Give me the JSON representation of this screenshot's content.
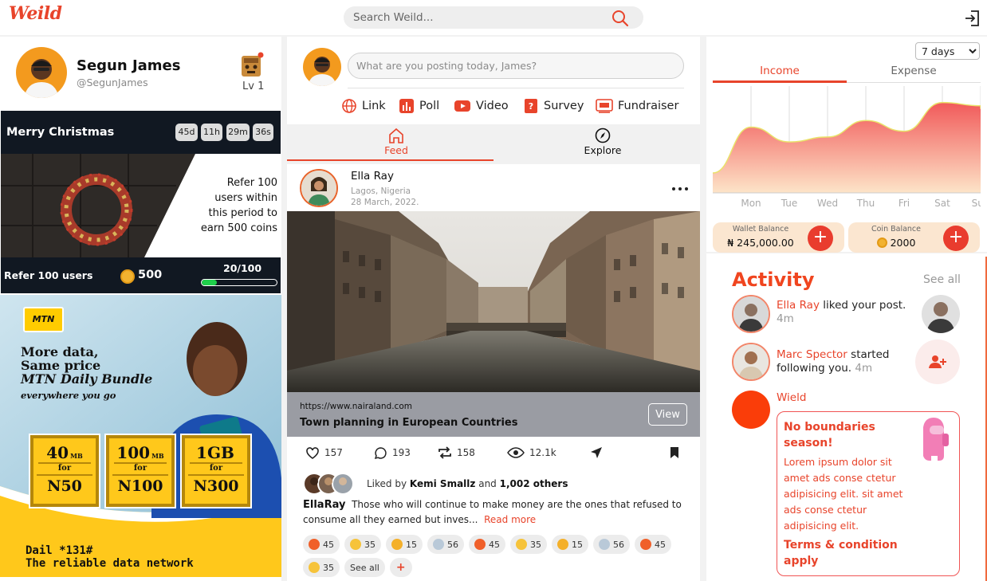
{
  "brand": {
    "logo": "Weild",
    "accent": "#e8442b"
  },
  "header": {
    "search_placeholder": "Search Weild...",
    "search_icon": "search-icon",
    "logout_icon": "logout-icon"
  },
  "profile": {
    "name": "Segun James",
    "handle": "@SegunJames",
    "level": "Lv 1"
  },
  "promo_card": {
    "title": "Merry Christmas",
    "countdown": [
      "45d",
      "11h",
      "29m",
      "36s"
    ],
    "refer_text": "Refer 100 users within this period to earn 500 coins",
    "refer_label": "Refer 100 users",
    "coins": "500",
    "progress_label": "20/100",
    "progress_fraction": 0.2
  },
  "ad": {
    "brand": "MTN",
    "line1": "More data,",
    "line2": "Same price",
    "line3": "MTN Daily Bundle",
    "line4": "everywhere you go",
    "bundles": [
      {
        "size": "40",
        "unit": "MB",
        "for": "for",
        "price": "N50"
      },
      {
        "size": "100",
        "unit": "MB",
        "for": "for",
        "price": "N100"
      },
      {
        "size": "1GB",
        "unit": "",
        "for": "for",
        "price": "N300"
      }
    ],
    "dial": "Dail *131#",
    "tagline": "The reliable data network"
  },
  "composer": {
    "placeholder": "What are you posting today, James?",
    "actions": [
      {
        "label": "Link",
        "icon": "globe-icon"
      },
      {
        "label": "Poll",
        "icon": "poll-icon"
      },
      {
        "label": "Video",
        "icon": "video-icon"
      },
      {
        "label": "Survey",
        "icon": "survey-icon"
      },
      {
        "label": "Fundraiser",
        "icon": "fundraiser-icon"
      }
    ]
  },
  "tabs": [
    {
      "label": "Feed",
      "icon": "home-icon",
      "active": true
    },
    {
      "label": "Explore",
      "icon": "compass-icon",
      "active": false
    }
  ],
  "post": {
    "author": "Ella Ray",
    "location": "Lagos, Nigeria",
    "date": "28 March, 2022.",
    "link_url": "https://www.nairaland.com",
    "link_title": "Town planning in European Countries",
    "view_label": "View",
    "stats": {
      "likes": "157",
      "comments": "193",
      "reposts": "158",
      "views": "12.1k"
    },
    "liked_by_prefix": "Liked by",
    "liked_by_name": "Kemi Smallz",
    "liked_by_and": "and",
    "liked_by_others": "1,002 others",
    "caption_user": "EllaRay",
    "caption_text": "Those who will continue to make money are the ones that refused to consume all they earned but inves...",
    "read_more": "Read more",
    "reactions": [
      {
        "emoji": "boom",
        "count": "45"
      },
      {
        "emoji": "laugh",
        "count": "35"
      },
      {
        "emoji": "hug",
        "count": "15"
      },
      {
        "emoji": "scream",
        "count": "56"
      },
      {
        "emoji": "boom",
        "count": "45"
      },
      {
        "emoji": "laugh",
        "count": "35"
      },
      {
        "emoji": "hug",
        "count": "15"
      },
      {
        "emoji": "scream",
        "count": "56"
      },
      {
        "emoji": "boom",
        "count": "45"
      },
      {
        "emoji": "laugh",
        "count": "35"
      }
    ],
    "see_all": "See all",
    "add_reaction": "+"
  },
  "stats_panel": {
    "range_options": [
      "7 days"
    ],
    "range_selected": "7 days",
    "tabs": [
      "Income",
      "Expense"
    ],
    "active_tab": "Income",
    "wallet_label": "Wallet Balance",
    "wallet_value": "₦ 245,000.00",
    "coin_label": "Coin Balance",
    "coin_value": "2000"
  },
  "chart_data": {
    "type": "area",
    "categories": [
      "Mon",
      "Tue",
      "Wed",
      "Thu",
      "Fri",
      "Sat",
      "Sun"
    ],
    "values": [
      80,
      62,
      68,
      88,
      75,
      110,
      106
    ],
    "ylim": [
      0,
      130
    ],
    "grid": "vertical",
    "colors": {
      "top": "#f15a5a",
      "bottom": "#fde4c8"
    },
    "title": "",
    "xlabel": "",
    "ylabel": ""
  },
  "activity": {
    "title": "Activity",
    "see_all": "See all",
    "items": [
      {
        "name": "Ella Ray",
        "text": "liked your post.",
        "time": "4m"
      },
      {
        "name": "Marc Spector",
        "text": "started following you.",
        "time": "4m"
      }
    ],
    "wield_name": "Wield",
    "promo_title": "No boundaries season!",
    "promo_body": "Lorem ipsum dolor sit amet ads conse ctetur adipisicing elit. sit amet ads conse ctetur adipisicing elit.",
    "promo_terms": "Terms & condition apply"
  }
}
